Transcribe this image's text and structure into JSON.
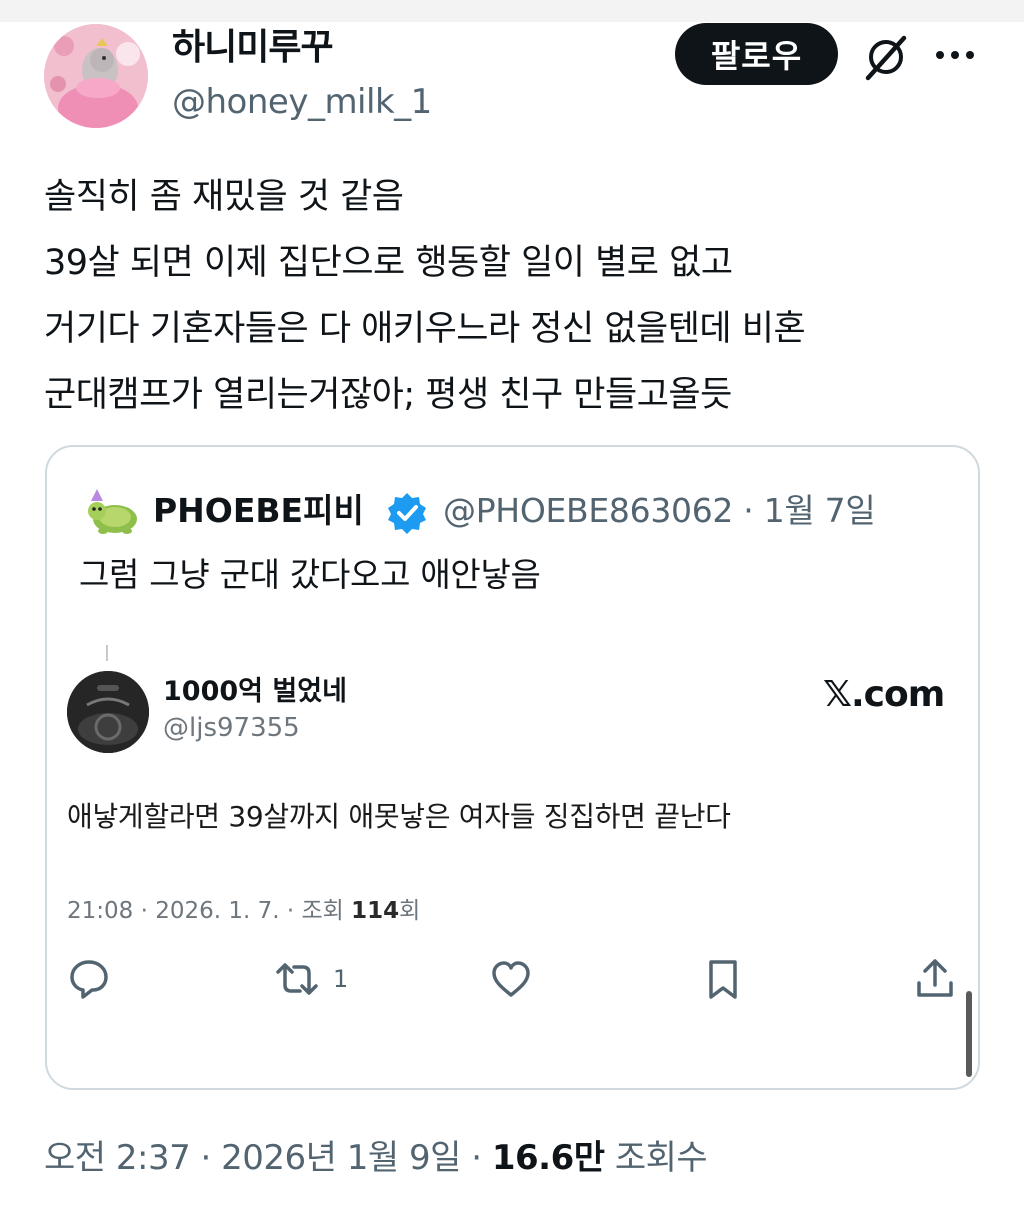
{
  "author": {
    "name": "하니미루꾸",
    "handle": "@honey_milk_1"
  },
  "header": {
    "follow_label": "팔로우"
  },
  "tweet": {
    "lines": [
      "솔직히 좀 재밌을 것 같음",
      "39살 되면 이제 집단으로 행동할 일이 별로 없고",
      "거기다 기혼자들은 다 애키우느라 정신 없을텐데 비혼",
      "군대캠프가 열리는거잖아; 평생 친구 만들고올듯"
    ],
    "time": "오전 2:37",
    "sep": " · ",
    "date": "2026년 1월 9일",
    "views": "16.6만",
    "views_label": " 조회수"
  },
  "quote": {
    "name": "PHOEBE피비",
    "handle": "@PHOEBE863062",
    "sep": " · ",
    "date": "1월 7일",
    "text": "그럼 그냥 군대 갔다오고 애안낳음",
    "embed": {
      "name": "1000억 벌었네",
      "handle": "@ljs97355",
      "source": "𝕏.com",
      "text": "애낳게할라면 39살까지 애못낳은 여자들 징집하면 끝난다",
      "meta_prefix": "21:08 · 2026. 1. 7. · 조회 ",
      "views": "114",
      "views_suffix": "회",
      "retweet_count": "1"
    }
  },
  "colors": {
    "text": "#0f1419",
    "secondary": "#536471",
    "border": "#cfd9de",
    "verified": "#1d9bf0"
  },
  "icons": [
    "grok-icon",
    "more-icon",
    "verified-icon",
    "reply-icon",
    "retweet-icon",
    "like-icon",
    "bookmark-icon",
    "share-icon"
  ]
}
